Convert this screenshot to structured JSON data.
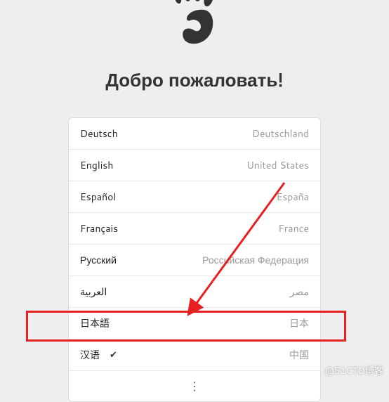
{
  "header": {
    "title": "Добро пожаловать!"
  },
  "languages": [
    {
      "name": "Deutsch",
      "region": "Deutschland",
      "selected": false
    },
    {
      "name": "English",
      "region": "United States",
      "selected": false
    },
    {
      "name": "Español",
      "region": "España",
      "selected": false
    },
    {
      "name": "Français",
      "region": "France",
      "selected": false
    },
    {
      "name": "Русский",
      "region": "Российская Федерация",
      "selected": false
    },
    {
      "name": "العربية",
      "region": "مصر",
      "selected": false
    },
    {
      "name": "日本語",
      "region": "日本",
      "selected": false
    },
    {
      "name": "汉语",
      "region": "中国",
      "selected": true
    }
  ],
  "icons": {
    "check": "✔",
    "more": "⋮"
  },
  "watermark": "@51CTO博客"
}
